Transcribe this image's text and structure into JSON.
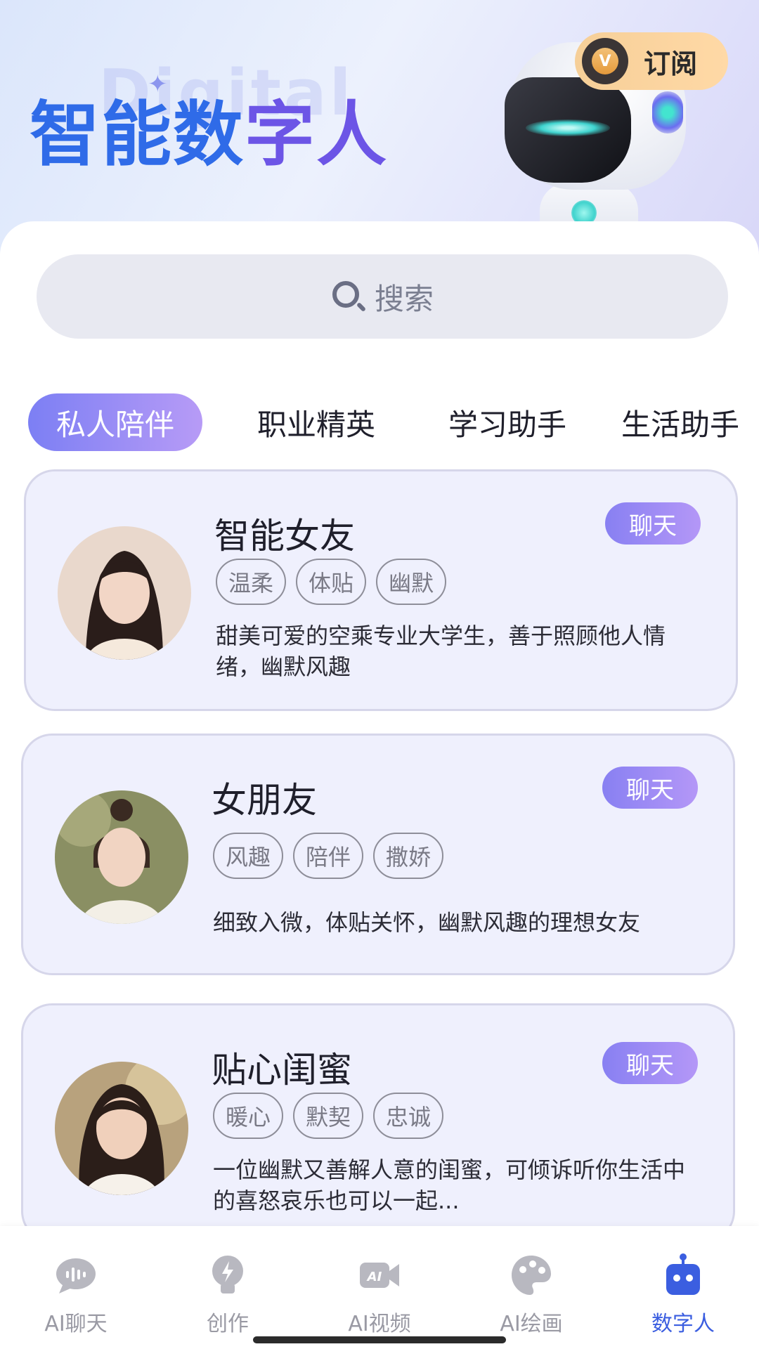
{
  "header": {
    "ghost_text": "Digital",
    "title_part1": "智能数",
    "title_part2": "字人",
    "subscribe_label": "订阅",
    "subscribe_badge": "V"
  },
  "search": {
    "placeholder": "搜索"
  },
  "tabs": [
    {
      "label": "私人陪伴",
      "active": true
    },
    {
      "label": "职业精英",
      "active": false
    },
    {
      "label": "学习助手",
      "active": false
    },
    {
      "label": "生活助手",
      "active": false
    }
  ],
  "cards": [
    {
      "title": "智能女友",
      "chat_label": "聊天",
      "tags": [
        "温柔",
        "体贴",
        "幽默"
      ],
      "description": "甜美可爱的空乘专业大学生，善于照顾他人情绪，幽默风趣"
    },
    {
      "title": "女朋友",
      "chat_label": "聊天",
      "tags": [
        "风趣",
        "陪伴",
        "撒娇"
      ],
      "description": "细致入微，体贴关怀，幽默风趣的理想女友"
    },
    {
      "title": "贴心闺蜜",
      "chat_label": "聊天",
      "tags": [
        "暖心",
        "默契",
        "忠诚"
      ],
      "description": "一位幽默又善解人意的闺蜜，可倾诉听你生活中的喜怒哀乐也可以一起..."
    }
  ],
  "bottom_nav": [
    {
      "label": "AI聊天",
      "icon": "chat-bubble-icon",
      "active": false
    },
    {
      "label": "创作",
      "icon": "lightbulb-icon",
      "active": false
    },
    {
      "label": "AI视频",
      "icon": "video-camera-icon",
      "active": false
    },
    {
      "label": "AI绘画",
      "icon": "palette-icon",
      "active": false
    },
    {
      "label": "数字人",
      "icon": "robot-icon",
      "active": true
    }
  ],
  "colors": {
    "accent": "#7c7ff4",
    "nav_active": "#3b5ee0",
    "card_bg": "#eff0fd"
  }
}
